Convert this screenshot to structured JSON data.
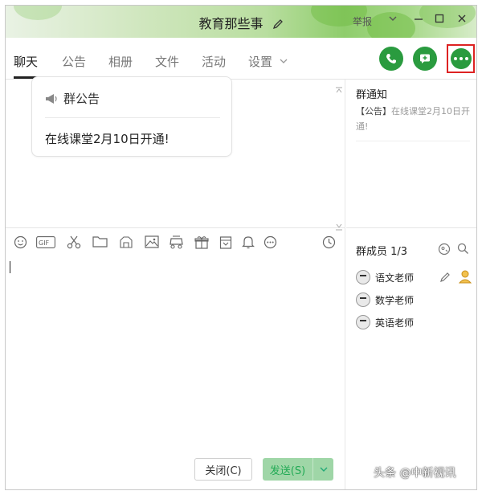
{
  "window": {
    "title": "教育那些事",
    "controls": {
      "report": "举报",
      "chevron": "chevron-down-icon",
      "minimize": "minimize-icon",
      "maximize": "maximize-icon",
      "close": "close-icon"
    }
  },
  "tabs": [
    {
      "label": "聊天",
      "active": true
    },
    {
      "label": "公告",
      "active": false
    },
    {
      "label": "相册",
      "active": false
    },
    {
      "label": "文件",
      "active": false
    },
    {
      "label": "活动",
      "active": false
    },
    {
      "label": "设置",
      "active": false
    }
  ],
  "header_actions": [
    "phone-icon",
    "add-chat-icon",
    "more-icon"
  ],
  "chat": {
    "notice_card": {
      "title": "群公告",
      "body": "在线课堂2月10日开通!"
    }
  },
  "toolbar_icons": [
    "emoji-icon",
    "gif-icon",
    "scissors-icon",
    "folder-icon",
    "flower-icon",
    "image-icon",
    "red-packet-icon",
    "gift-icon",
    "calendar-icon",
    "bell-icon",
    "more-circle-icon",
    "clock-icon"
  ],
  "input": {
    "value": "",
    "close_label": "关闭(C)",
    "send_label": "发送(S)"
  },
  "sidebar": {
    "notice_title": "群通知",
    "notice_prefix": "【公告】",
    "notice_text": "在线课堂2月10日开通!",
    "members_title": "群成员 1/3",
    "members": [
      {
        "name": "语文老师"
      },
      {
        "name": "数学老师"
      },
      {
        "name": "英语老师"
      }
    ]
  },
  "watermark": "头条 @中新视讯",
  "colors": {
    "accent": "#2a9b3f",
    "highlight_box": "#dd2222",
    "send_button": "#9fd6a7"
  }
}
